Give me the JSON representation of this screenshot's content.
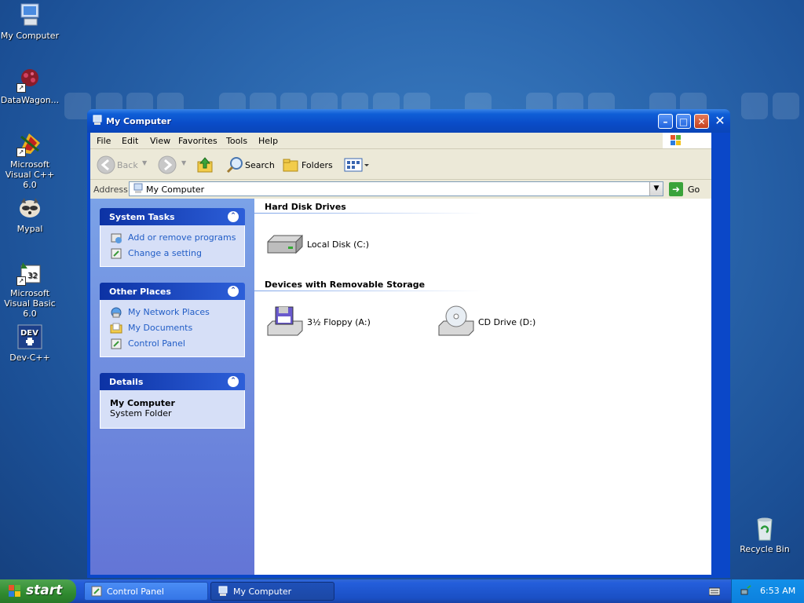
{
  "desktop": {
    "icons": [
      {
        "label": "My Computer"
      },
      {
        "label": "DataWagon..."
      },
      {
        "label": "Microsoft Visual C++ 6.0"
      },
      {
        "label": "Mypal"
      },
      {
        "label": "Microsoft Visual Basic 6.0"
      },
      {
        "label": "Dev-C++"
      },
      {
        "label": "Recycle Bin"
      }
    ]
  },
  "window": {
    "title": "My Computer",
    "menu": [
      "File",
      "Edit",
      "View",
      "Favorites",
      "Tools",
      "Help"
    ],
    "toolbar": {
      "back": "Back",
      "search": "Search",
      "folders": "Folders"
    },
    "address": {
      "label": "Address",
      "value": "My Computer",
      "go": "Go"
    },
    "taskpane": {
      "system_tasks": {
        "title": "System Tasks",
        "items": [
          "Add or remove programs",
          "Change a setting"
        ]
      },
      "other_places": {
        "title": "Other Places",
        "items": [
          "My Network Places",
          "My Documents",
          "Control Panel"
        ]
      },
      "details": {
        "title": "Details",
        "name": "My Computer",
        "type": "System Folder"
      }
    },
    "content": {
      "hard_disk_group": "Hard Disk Drives",
      "hard_disks": [
        "Local Disk (C:)"
      ],
      "removable_group": "Devices with Removable Storage",
      "removable": [
        "3½ Floppy (A:)",
        "CD Drive (D:)"
      ]
    }
  },
  "taskbar": {
    "start": "start",
    "tasks": [
      "Control Panel",
      "My Computer"
    ],
    "clock": "6:53 AM"
  },
  "colors": {
    "desktop": "#2a66ad",
    "titlebar": "#0a4cc8",
    "taskpane": "#6f8fdf",
    "link": "#215dc6",
    "start": "#2f8a2f"
  }
}
